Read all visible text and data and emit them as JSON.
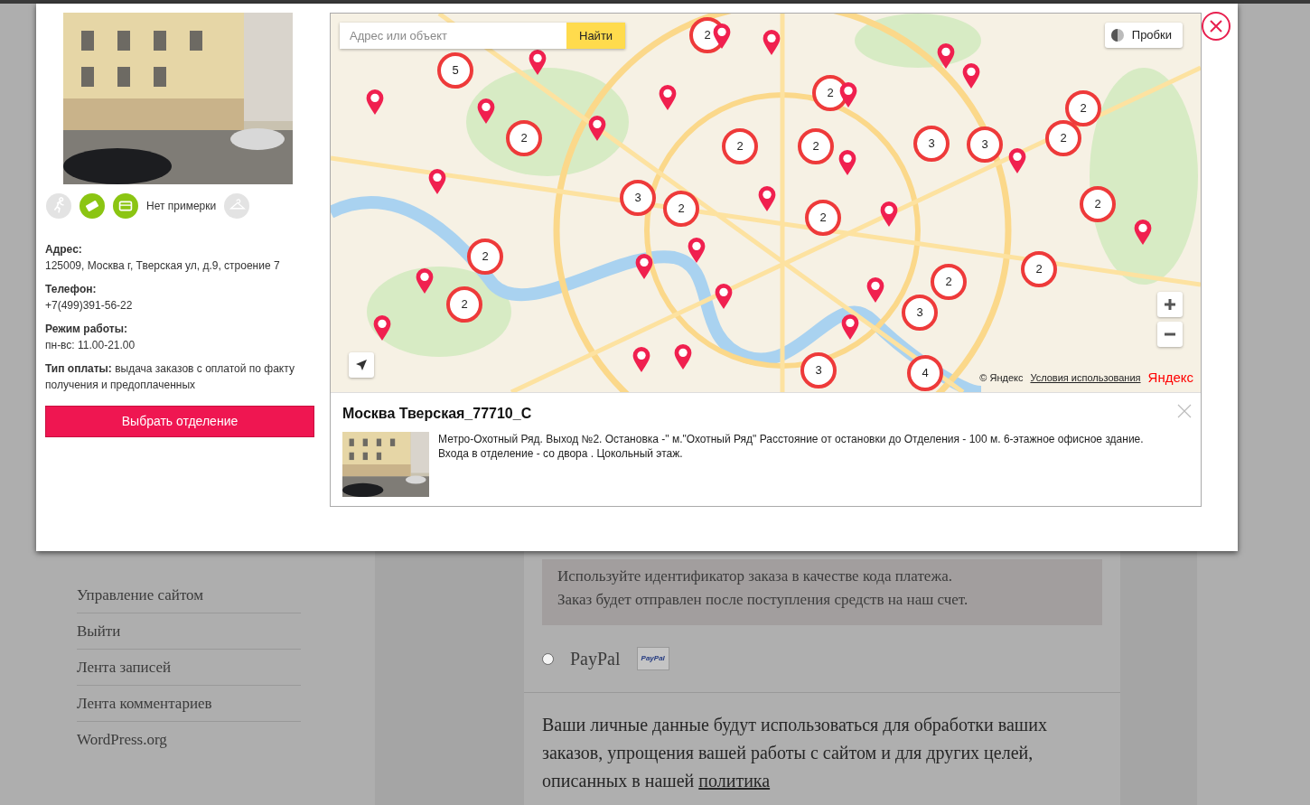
{
  "page": {
    "sidebar_links": [
      "Управление сайтом",
      "Выйти",
      "Лента записей",
      "Лента комментариев",
      "WordPress.org"
    ],
    "payment_note": [
      "Используйте идентификатор заказа в качестве кода платежа.",
      "Заказ будет отправлен после поступления средств на наш счет."
    ],
    "payment_option": {
      "label": "PayPal",
      "selected": false,
      "logo": "PayPal"
    },
    "privacy": {
      "text": "Ваши личные данные будут использоваться для обработки ваших заказов, упрощения вашей работы с сайтом и для других целей, описанных в нашей",
      "link": "политика"
    }
  },
  "modal": {
    "left_panel": {
      "features": [
        {
          "kind": "walk",
          "active": false
        },
        {
          "kind": "voucher",
          "active": true
        },
        {
          "kind": "card",
          "active": true
        },
        {
          "kind": "label",
          "text": "Нет примерки"
        },
        {
          "kind": "hanger",
          "active": false
        }
      ],
      "info": [
        {
          "kind": "block",
          "label": "Адрес:",
          "value": "125009, Москва г, Тверская ул, д.9, строение 7"
        },
        {
          "kind": "block",
          "label": "Телефон:",
          "value": "+7(499)391-56-22"
        },
        {
          "kind": "block",
          "label": "Режим работы:",
          "value": "пн-вс: 11.00-21.00"
        },
        {
          "kind": "inline",
          "label": "Тип оплаты:",
          "value": "выдача заказов с оплатой по факту получения и предоплаченных"
        }
      ],
      "select_button": "Выбрать отделение"
    },
    "map": {
      "search": {
        "placeholder": "Адрес или объект",
        "button": "Найти"
      },
      "traffic_button": "Пробки",
      "clusters": [
        "5",
        "2",
        "2",
        "2",
        "2",
        "2",
        "3",
        "3",
        "2",
        "2",
        "3",
        "2",
        "2",
        "2",
        "2",
        "2",
        "2",
        "2",
        "3",
        "3",
        "4"
      ],
      "copyright": "© Яндекс",
      "terms_link": "Условия использования",
      "logo": "Яндекс"
    },
    "balloon": {
      "title": "Москва Тверская_77710_С",
      "description": "Метро-Охотный Ряд. Выход №2. Остановка -\" м.\"Охотный Ряд\" Расстояние от остановки до Отделения - 100 м. 6-этажное офисное здание. Входа в отделение - со двора . Цокольный этаж."
    }
  }
}
